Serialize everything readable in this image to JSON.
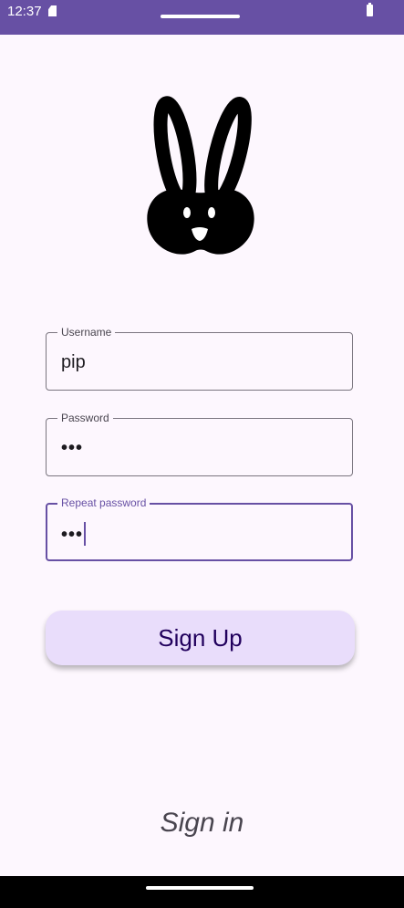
{
  "status_bar": {
    "time": "12:37",
    "icons": [
      "sd-card-icon",
      "battery-icon"
    ]
  },
  "logo": {
    "icon": "rabbit-icon"
  },
  "form": {
    "username": {
      "label": "Username",
      "value": "pip"
    },
    "password": {
      "label": "Password",
      "value": "•••"
    },
    "repeat_password": {
      "label": "Repeat password",
      "value": "•••"
    }
  },
  "actions": {
    "signup_label": "Sign Up",
    "signin_label": "Sign in"
  },
  "colors": {
    "primary": "#6750a4",
    "background": "#fdf7fe",
    "button_container": "#e9ddfb",
    "button_text": "#21005d",
    "outline": "#7a757f"
  }
}
